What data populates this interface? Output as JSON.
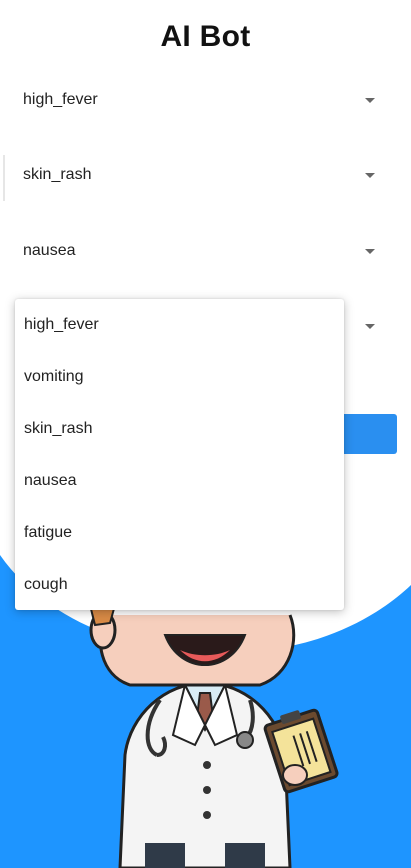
{
  "app": {
    "title": "AI Bot"
  },
  "selectors": [
    {
      "value": "high_fever"
    },
    {
      "value": "skin_rash"
    },
    {
      "value": "nausea"
    },
    {
      "value": ""
    }
  ],
  "dropdown": {
    "options": [
      "high_fever",
      "vomiting",
      "skin_rash",
      "nausea",
      "fatigue",
      "cough"
    ]
  },
  "colors": {
    "accent": "#1e95ff",
    "button": "#2a8ff0"
  },
  "illustration": {
    "icon": "doctor-illustration"
  }
}
